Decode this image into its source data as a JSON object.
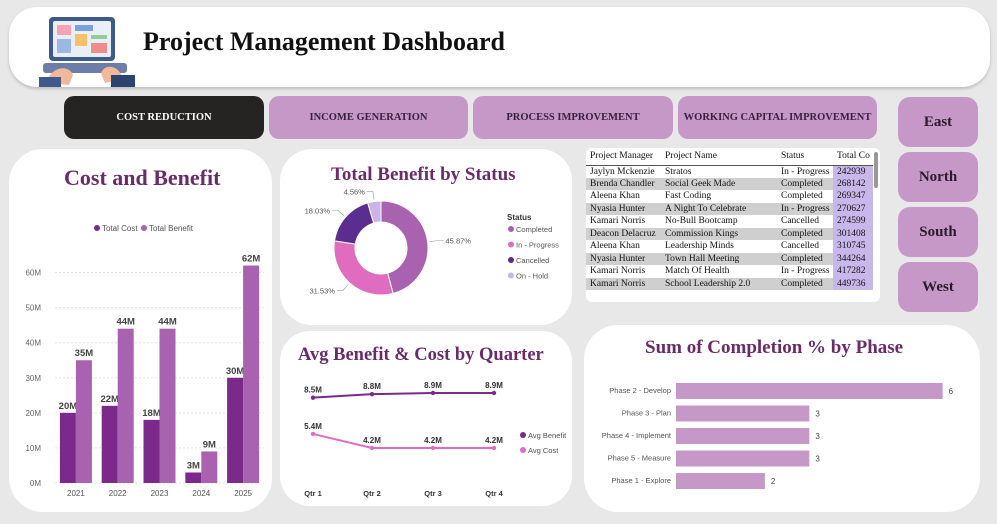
{
  "header": {
    "title": "Project Management Dashboard"
  },
  "tabs": [
    {
      "label": "COST REDUCTION",
      "active": true
    },
    {
      "label": "INCOME GENERATION",
      "active": false
    },
    {
      "label": "PROCESS IMPROVEMENT",
      "active": false
    },
    {
      "label": "WORKING CAPITAL IMPROVEMENT",
      "active": false
    }
  ],
  "regions": [
    "East",
    "North",
    "South",
    "West"
  ],
  "colors": {
    "accent": "#c598c8",
    "dark_purple": "#7b2a8c",
    "light_purple": "#a862b0",
    "title": "#6b2b6b"
  },
  "cost_benefit": {
    "title": "Cost and Benefit",
    "legend": [
      "Total Cost",
      "Total Benefit"
    ]
  },
  "total_benefit": {
    "title": "Total Benefit by Status",
    "legend_title": "Status",
    "legend": [
      "Completed",
      "In - Progress",
      "Cancelled",
      "On - Hold"
    ]
  },
  "table": {
    "columns": [
      "Project Manager",
      "Project Name",
      "Status",
      "Total Co"
    ],
    "rows": [
      [
        "Jaylyn Mckenzie",
        "Stratos",
        "In - Progress",
        "242939"
      ],
      [
        "Brenda Chandler",
        "Social Geek Made",
        "Completed",
        "268142"
      ],
      [
        "Aleena Khan",
        "Fast Coding",
        "Completed",
        "269347"
      ],
      [
        "Nyasia Hunter",
        "A Night To Celebrate",
        "In - Progress",
        "270627"
      ],
      [
        "Kamari Norris",
        "No-Bull Bootcamp",
        "Cancelled",
        "274599"
      ],
      [
        "Deacon Delacruz",
        "Commission Kings",
        "Completed",
        "301408"
      ],
      [
        "Aleena Khan",
        "Leadership Minds",
        "Cancelled",
        "310745"
      ],
      [
        "Nyasia Hunter",
        "Town Hall Meeting",
        "Completed",
        "344264"
      ],
      [
        "Kamari Norris",
        "Match Of Health",
        "In - Progress",
        "417282"
      ],
      [
        "Kamari Norris",
        "School Leadership 2.0",
        "Completed",
        "449736"
      ]
    ]
  },
  "avg_quarter": {
    "title": "Avg Benefit & Cost by Quarter",
    "legend": [
      "Avg Benefit",
      "Avg Cost"
    ]
  },
  "completion": {
    "title": "Sum of Completion % by Phase"
  },
  "chart_data": [
    {
      "type": "bar",
      "title": "Cost and Benefit",
      "categories": [
        "2021",
        "2022",
        "2023",
        "2024",
        "2025"
      ],
      "series": [
        {
          "name": "Total Cost",
          "values": [
            20,
            22,
            18,
            3,
            30
          ],
          "labels": [
            "20M",
            "22M",
            "18M",
            "3M",
            "30M"
          ],
          "color": "#7b2a8c"
        },
        {
          "name": "Total Benefit",
          "values": [
            35,
            44,
            44,
            9,
            62
          ],
          "labels": [
            "35M",
            "44M",
            "44M",
            "9M",
            "62M"
          ],
          "color": "#a862b0"
        }
      ],
      "ylim": [
        0,
        65
      ],
      "yticks": [
        "0M",
        "10M",
        "20M",
        "30M",
        "40M",
        "50M",
        "60M"
      ],
      "ytick_values": [
        0,
        10,
        20,
        30,
        40,
        50,
        60
      ]
    },
    {
      "type": "pie",
      "title": "Total Benefit by Status",
      "categories": [
        "Completed",
        "In - Progress",
        "Cancelled",
        "On - Hold"
      ],
      "values": [
        45.87,
        31.53,
        18.03,
        4.56
      ],
      "labels": [
        "45.87%",
        "31.53%",
        "18.03%",
        "4.56%"
      ],
      "colors": [
        "#a862b0",
        "#e06cc0",
        "#5b2d8e",
        "#c9b3e8"
      ]
    },
    {
      "type": "line",
      "title": "Avg Benefit & Cost by Quarter",
      "categories": [
        "Qtr 1",
        "Qtr 2",
        "Qtr 3",
        "Qtr 4"
      ],
      "series": [
        {
          "name": "Avg Benefit",
          "values": [
            8.5,
            8.8,
            8.9,
            8.9
          ],
          "labels": [
            "8.5M",
            "8.8M",
            "8.9M",
            "8.9M"
          ],
          "color": "#7b2a8c"
        },
        {
          "name": "Avg Cost",
          "values": [
            5.4,
            4.2,
            4.2,
            4.2
          ],
          "labels": [
            "5.4M",
            "4.2M",
            "4.2M",
            "4.2M"
          ],
          "color": "#e06cc0"
        }
      ]
    },
    {
      "type": "bar",
      "orientation": "horizontal",
      "title": "Sum of Completion % by Phase",
      "categories": [
        "Phase 2 - Develop",
        "Phase 3 - Plan",
        "Phase 4 - Implement",
        "Phase 5 - Measure",
        "Phase 1 - Explore"
      ],
      "values": [
        6,
        3,
        3,
        3,
        2
      ],
      "xlim": [
        0,
        6.3
      ],
      "color": "#c598c8"
    }
  ]
}
